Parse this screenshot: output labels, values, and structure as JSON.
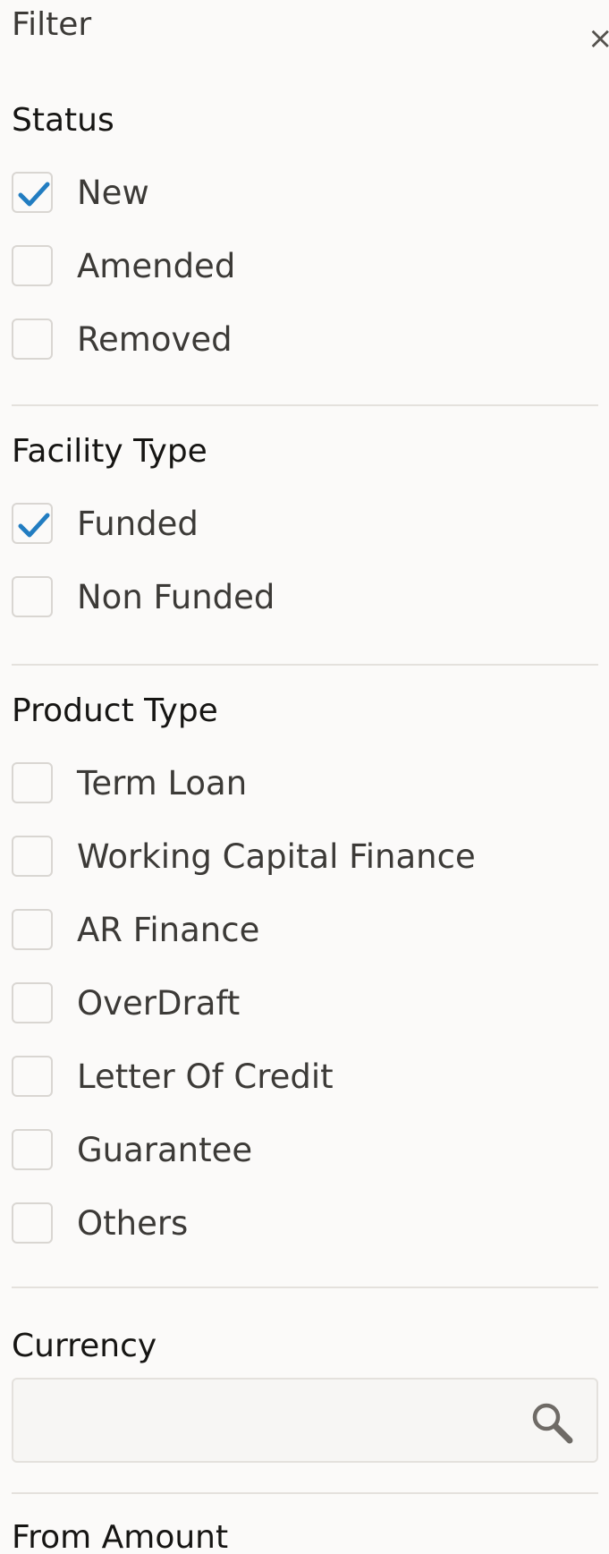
{
  "header": {
    "title": "Filter",
    "close_glyph": "×"
  },
  "status": {
    "title": "Status",
    "options": [
      {
        "label": "New",
        "checked": true
      },
      {
        "label": "Amended",
        "checked": false
      },
      {
        "label": "Removed",
        "checked": false
      }
    ]
  },
  "facility_type": {
    "title": "Facility Type",
    "options": [
      {
        "label": "Funded",
        "checked": true
      },
      {
        "label": "Non Funded",
        "checked": false
      }
    ]
  },
  "product_type": {
    "title": "Product Type",
    "options": [
      {
        "label": "Term Loan",
        "checked": false
      },
      {
        "label": "Working Capital Finance",
        "checked": false
      },
      {
        "label": "AR Finance",
        "checked": false
      },
      {
        "label": "OverDraft",
        "checked": false
      },
      {
        "label": "Letter Of Credit",
        "checked": false
      },
      {
        "label": "Guarantee",
        "checked": false
      },
      {
        "label": "Others",
        "checked": false
      }
    ]
  },
  "currency": {
    "title": "Currency",
    "value": "",
    "placeholder": "",
    "icon": "search-icon"
  },
  "from_amount": {
    "title": "From Amount"
  },
  "colors": {
    "accent": "#227dc1",
    "border": "#d9d6d2",
    "divider": "#e4e1dd"
  }
}
